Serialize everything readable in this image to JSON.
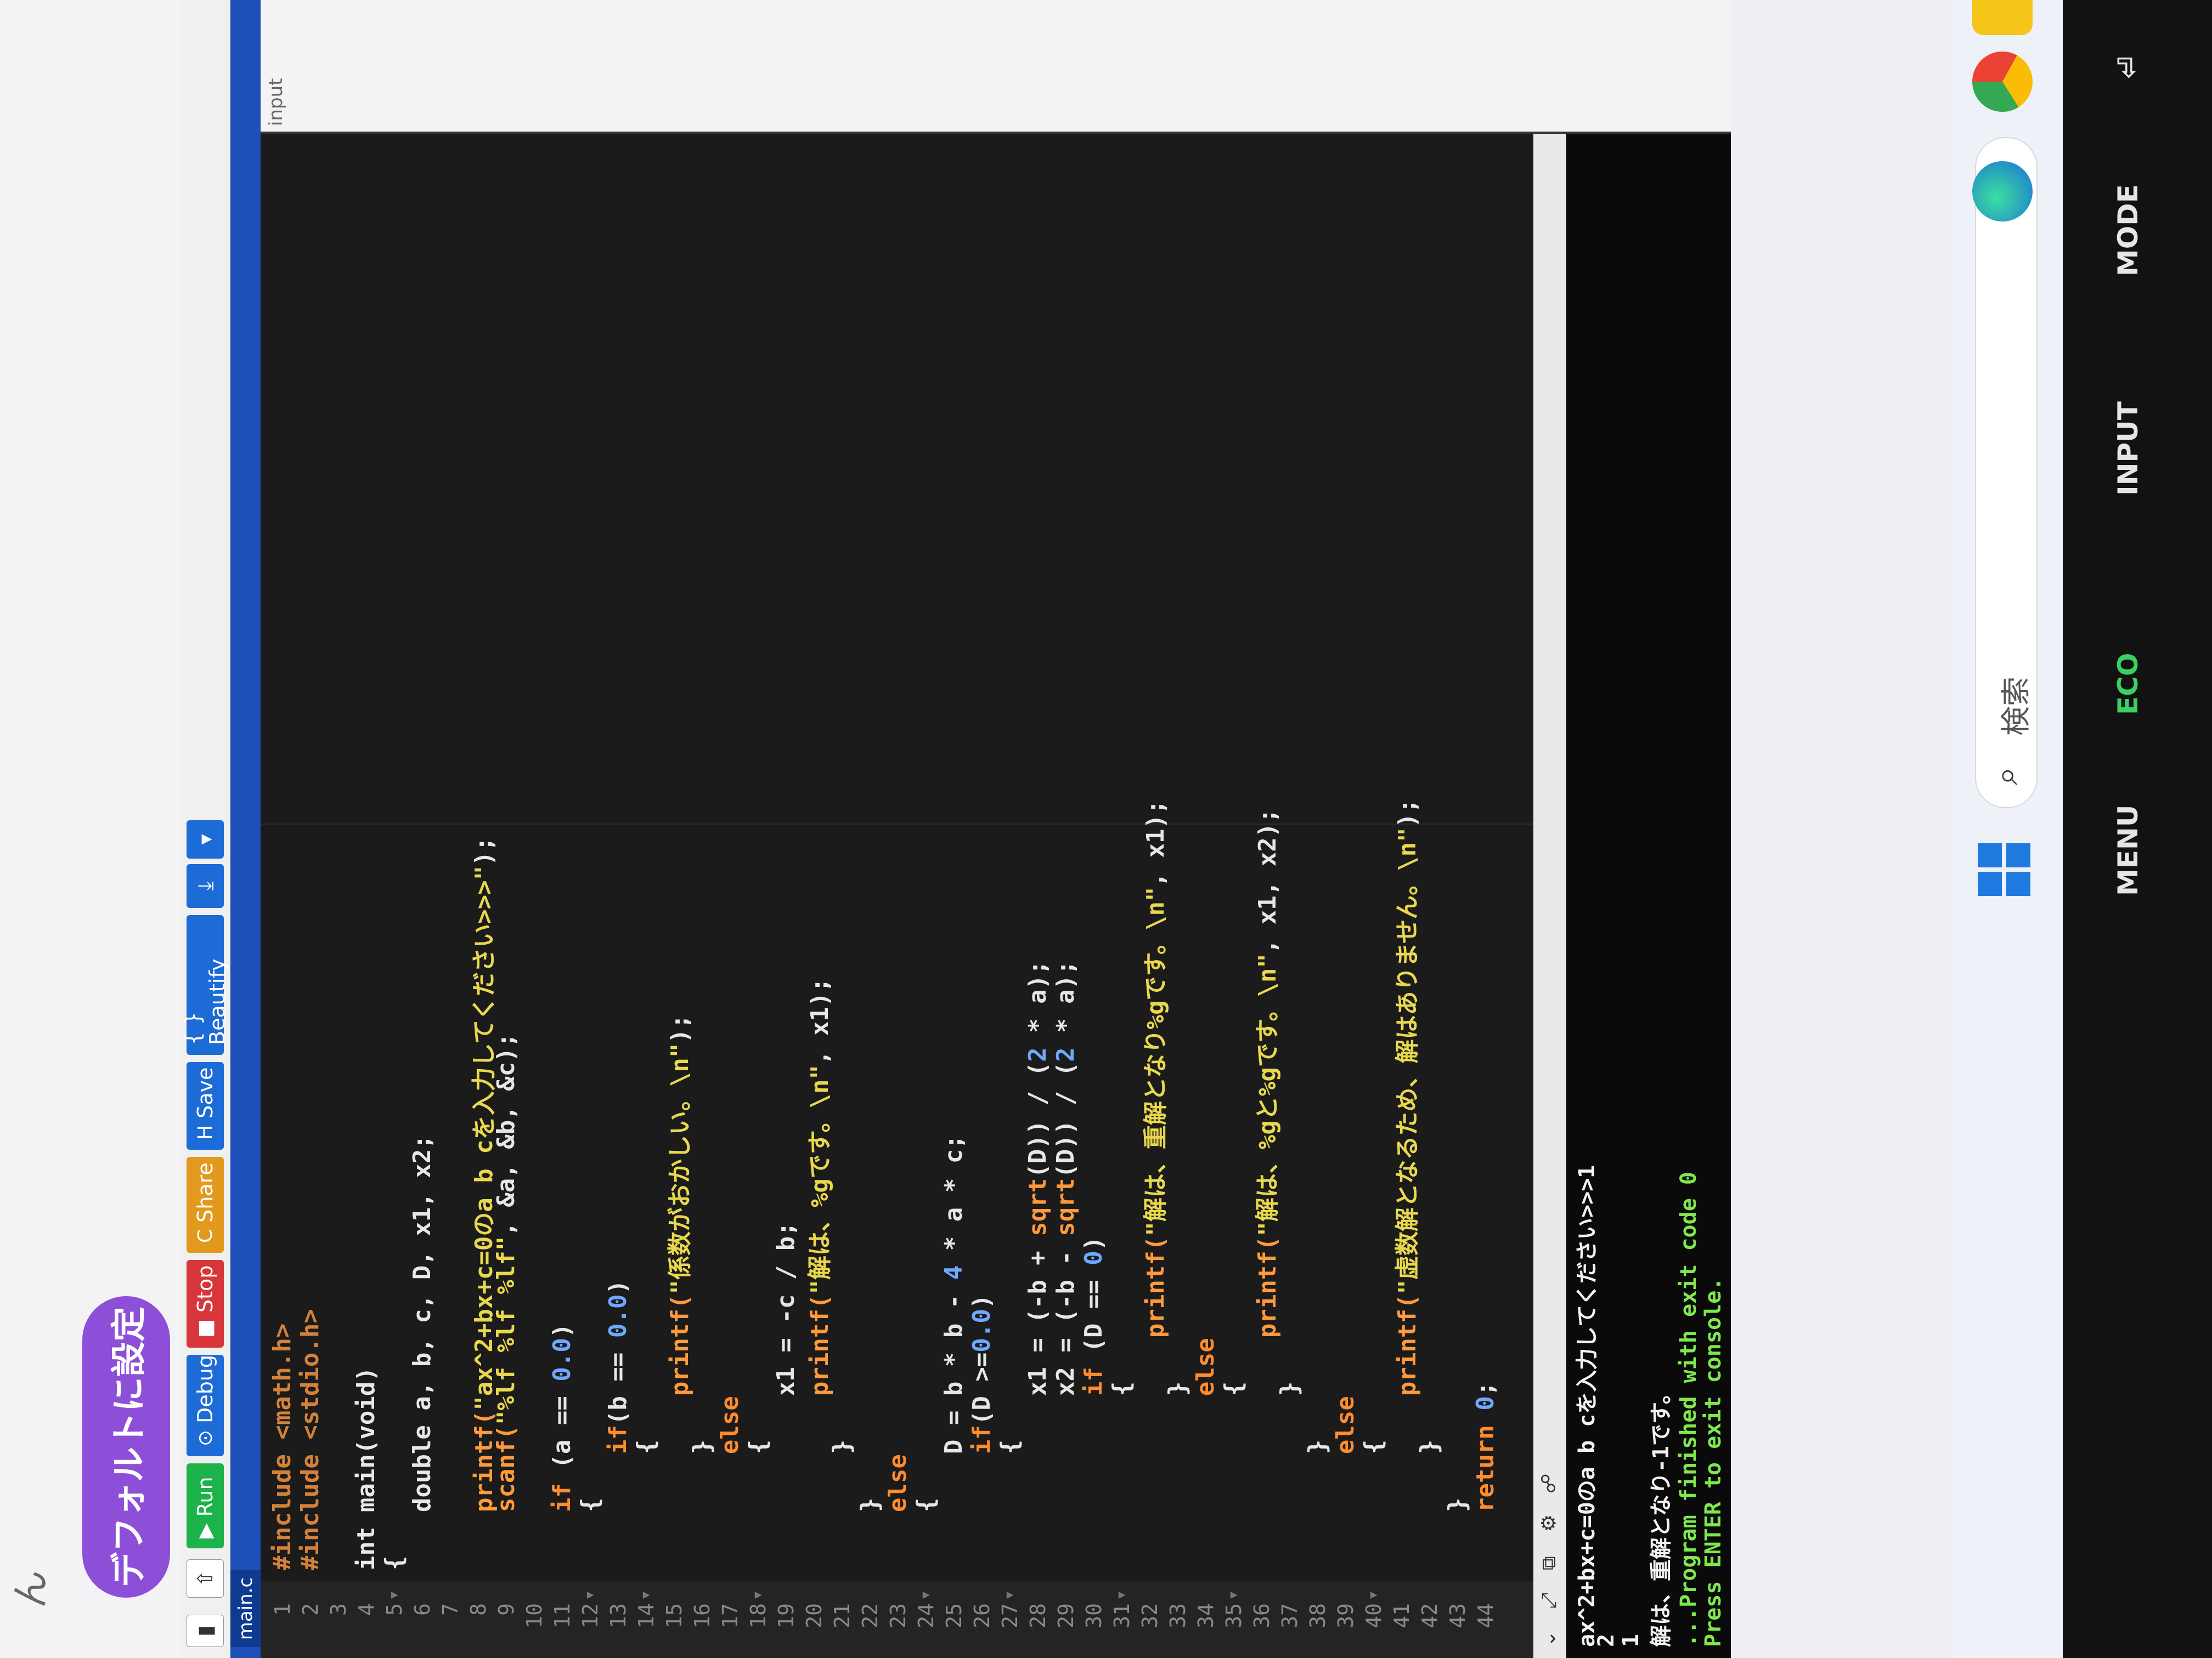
{
  "top": {
    "glyph": "ん",
    "default_button": "デフォルトに設定"
  },
  "toolbar": {
    "run": "Run",
    "debug": "Debug",
    "stop": "Stop",
    "share": "Share",
    "save": "Save",
    "beautify": "{ } Beautify"
  },
  "tab": {
    "label": "main.c"
  },
  "code": {
    "l1": "#include <math.h>",
    "l2": "#include <stdio.h>",
    "l4": "int main(void)",
    "l5": "{",
    "l6": "    double a, b, c, D, x1, x2;",
    "l8a": "    printf(",
    "l8b": "\"ax^2+bx+c=0のa b cを入力してください>>>\"",
    "l8c": ");",
    "l9a": "    scanf(",
    "l9b": "\"%lf %lf %lf\"",
    "l9c": ", &a, &b, &c);",
    "l11a": "    if",
    "l11b": " (a == ",
    "l11c": "0.0",
    "l11d": ")",
    "l12": "    {",
    "l13a": "        if",
    "l13b": "(b == ",
    "l13c": "0.0",
    "l13d": ")",
    "l14": "        {",
    "l15a": "            printf(",
    "l15b": "\"係数がおかしい。\\n\"",
    "l15c": ");",
    "l16": "        }",
    "l17": "        else",
    "l18": "        {",
    "l19": "            x1 = -c / b;",
    "l20a": "            printf(",
    "l20b": "\"解は、%gです。\\n\"",
    "l20c": ", x1);",
    "l21": "        }",
    "l22": "    }",
    "l23": "    else",
    "l24": "    {",
    "l25a": "        D = b * b - ",
    "l25b": "4",
    "l25c": " * a * c;",
    "l26a": "        if",
    "l26b": "(D >=",
    "l26c": "0.0",
    "l26d": ")",
    "l27": "        {",
    "l28a": "            x1 = (-b + ",
    "l28b": "sqrt",
    "l28c": "(D)) / (",
    "l28d": "2",
    "l28e": " * a);",
    "l29a": "            x2 = (-b - ",
    "l29b": "sqrt",
    "l29c": "(D)) / (",
    "l29d": "2",
    "l29e": " * a);",
    "l30a": "            if",
    "l30b": " (D == ",
    "l30c": "0",
    "l30d": ")",
    "l31": "            {",
    "l32a": "                printf(",
    "l32b": "\"解は、重解となり%gです。\\n\"",
    "l32c": ", x1);",
    "l33": "            }",
    "l34": "            else",
    "l35": "            {",
    "l36a": "                printf(",
    "l36b": "\"解は、%gと%gです。\\n\"",
    "l36c": ", x1, x2);",
    "l37": "            }",
    "l38": "        }",
    "l39": "        else",
    "l40": "        {",
    "l41a": "            printf(",
    "l41b": "\"虚数解となるため、解はありません。\\n\"",
    "l41c": ");",
    "l42": "        }",
    "l43": "    }",
    "l44a": "    return ",
    "l44b": "0",
    "l44c": ";"
  },
  "console": {
    "line1": "ax^2+bx+c=0のa b cを入力してください>>>1",
    "line2": "2",
    "line3": "1",
    "line4": "解は、重解となり-1です。",
    "line5": "",
    "line6": "...Program finished with exit code 0",
    "line7": "Press ENTER to exit console."
  },
  "input_panel": {
    "label": "input"
  },
  "taskbar": {
    "search_label": "検索"
  },
  "bezel": {
    "menu": "MENU",
    "eco": "ECO",
    "input": "INPUT",
    "mode": "MODE"
  },
  "colors": {
    "editor_bg": "#1b1b1b",
    "run": "#1cb34a",
    "debug": "#1d6bd6",
    "stop": "#d7373b",
    "share": "#e19a1d",
    "accent": "#8e4fd8"
  }
}
